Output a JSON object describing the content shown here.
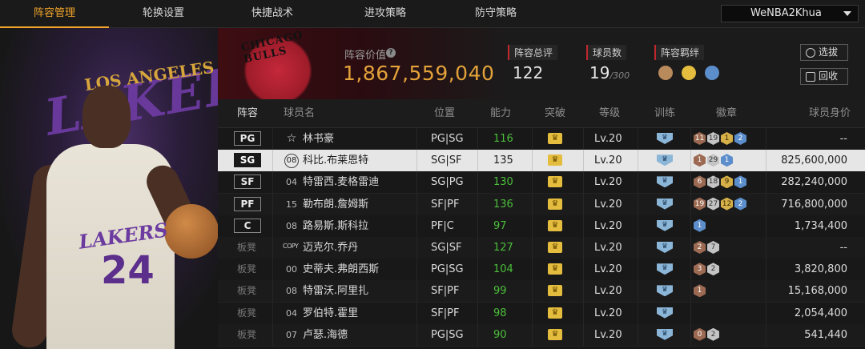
{
  "nav": {
    "tabs": [
      {
        "label": "阵容管理",
        "active": true
      },
      {
        "label": "轮换设置",
        "active": false
      },
      {
        "label": "快捷战术",
        "active": false
      },
      {
        "label": "进攻策略",
        "active": false
      },
      {
        "label": "防守策略",
        "active": false
      }
    ],
    "account": "WeNBA2Khua"
  },
  "showcase": {
    "team_word": "LAKERS",
    "team_word_top": "LOS ANGELES",
    "jersey_text": "LAKERS",
    "jersey_number": "24"
  },
  "summary": {
    "logo_text": "CHICAGO BULLS",
    "value_label": "阵容价值",
    "value": "1,867,559,040",
    "overall_label": "阵容总评",
    "overall": "122",
    "count_label": "球员数",
    "count": "19",
    "count_max": "/300",
    "bond_label": "阵容羁绊",
    "select_button": "选拔",
    "recycle_button": "回收",
    "colors": {
      "accent": "#e3a23a",
      "red": "#c1272d"
    }
  },
  "table": {
    "headers": [
      "阵容",
      "球员名",
      "位置",
      "能力",
      "突破",
      "等级",
      "训练",
      "徽章",
      "球员身价"
    ],
    "rows": [
      {
        "slot": "PG",
        "starter": true,
        "badge": "star",
        "num": "",
        "name": "林书豪",
        "position": "PG|SG",
        "ability": "116",
        "green": true,
        "level": "Lv.20",
        "badges": [
          {
            "t": "b",
            "v": "11"
          },
          {
            "t": "s",
            "v": "19"
          },
          {
            "t": "g",
            "v": "1"
          },
          {
            "t": "u",
            "v": "2"
          }
        ],
        "salary": "--"
      },
      {
        "slot": "SG",
        "starter": true,
        "badge": "circle",
        "num": "08",
        "name": "科比.布莱恩特",
        "position": "SG|SF",
        "ability": "135",
        "green": false,
        "level": "Lv.20",
        "badges": [
          {
            "t": "b",
            "v": "1"
          },
          {
            "t": "s",
            "v": "29"
          },
          {
            "t": "u",
            "v": "1"
          }
        ],
        "salary": "825,600,000",
        "selected": true
      },
      {
        "slot": "SF",
        "starter": true,
        "badge": "num",
        "num": "04",
        "name": "特雷西.麦格雷迪",
        "position": "SG|PG",
        "ability": "130",
        "green": true,
        "level": "Lv.20",
        "badges": [
          {
            "t": "b",
            "v": "6"
          },
          {
            "t": "s",
            "v": "18"
          },
          {
            "t": "g",
            "v": "9"
          },
          {
            "t": "u",
            "v": "1"
          }
        ],
        "salary": "282,240,000"
      },
      {
        "slot": "PF",
        "starter": true,
        "badge": "num",
        "num": "15",
        "name": "勒布朗.詹姆斯",
        "position": "SF|PF",
        "ability": "136",
        "green": true,
        "level": "Lv.20",
        "badges": [
          {
            "t": "b",
            "v": "19"
          },
          {
            "t": "s",
            "v": "27"
          },
          {
            "t": "g",
            "v": "12"
          },
          {
            "t": "u",
            "v": "2"
          }
        ],
        "salary": "716,800,000"
      },
      {
        "slot": "C",
        "starter": true,
        "badge": "num",
        "num": "08",
        "name": "路易斯.斯科拉",
        "position": "PF|C",
        "ability": "97",
        "green": true,
        "level": "Lv.20",
        "badges": [
          {
            "t": "u",
            "v": "1"
          }
        ],
        "salary": "1,734,400"
      },
      {
        "slot": "板凳",
        "starter": false,
        "badge": "copy",
        "num": "COPY",
        "name": "迈克尔.乔丹",
        "position": "SG|SF",
        "ability": "127",
        "green": true,
        "level": "Lv.20",
        "badges": [
          {
            "t": "b",
            "v": "2"
          },
          {
            "t": "s",
            "v": "7"
          }
        ],
        "salary": "--"
      },
      {
        "slot": "板凳",
        "starter": false,
        "badge": "num",
        "num": "00",
        "name": "史蒂夫.弗朗西斯",
        "position": "PG|SG",
        "ability": "104",
        "green": true,
        "level": "Lv.20",
        "badges": [
          {
            "t": "b",
            "v": "3"
          },
          {
            "t": "s",
            "v": "2"
          }
        ],
        "salary": "3,820,800"
      },
      {
        "slot": "板凳",
        "starter": false,
        "badge": "num",
        "num": "08",
        "name": "特雷沃.阿里扎",
        "position": "SF|PF",
        "ability": "99",
        "green": true,
        "level": "Lv.20",
        "badges": [
          {
            "t": "b",
            "v": "1"
          }
        ],
        "salary": "15,168,000"
      },
      {
        "slot": "板凳",
        "starter": false,
        "badge": "num",
        "num": "04",
        "name": "罗伯特.霍里",
        "position": "SF|PF",
        "ability": "98",
        "green": true,
        "level": "Lv.20",
        "badges": [],
        "salary": "2,054,400"
      },
      {
        "slot": "板凳",
        "starter": false,
        "badge": "num",
        "num": "07",
        "name": "卢瑟.海德",
        "position": "PG|SG",
        "ability": "90",
        "green": true,
        "level": "Lv.20",
        "badges": [
          {
            "t": "b",
            "v": "0"
          },
          {
            "t": "s",
            "v": "2"
          }
        ],
        "salary": "541,440"
      }
    ]
  }
}
